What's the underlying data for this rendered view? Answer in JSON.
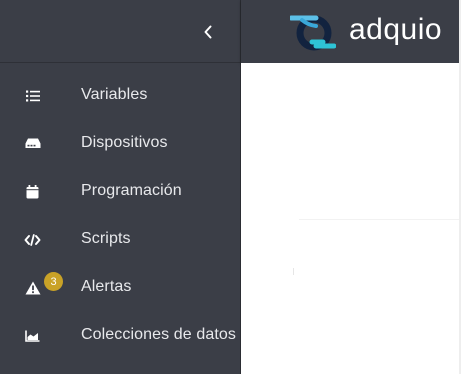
{
  "header": {
    "brand": "adquio",
    "accent": "#2ec4d6"
  },
  "sidebar": {
    "collapse_icon": "chevron-left-icon",
    "items": [
      {
        "label": "Variables",
        "icon": "list-icon"
      },
      {
        "label": "Dispositivos",
        "icon": "device-icon"
      },
      {
        "label": "Programación",
        "icon": "calendar-icon"
      },
      {
        "label": "Scripts",
        "icon": "code-icon"
      },
      {
        "label": "Alertas",
        "icon": "warning-icon",
        "badge": "3"
      },
      {
        "label": "Colecciones de datos",
        "icon": "chart-area-icon"
      }
    ]
  },
  "colors": {
    "sidebar_bg": "#3b3e47",
    "badge": "#c9a227",
    "content_bg": "#ffffff"
  }
}
